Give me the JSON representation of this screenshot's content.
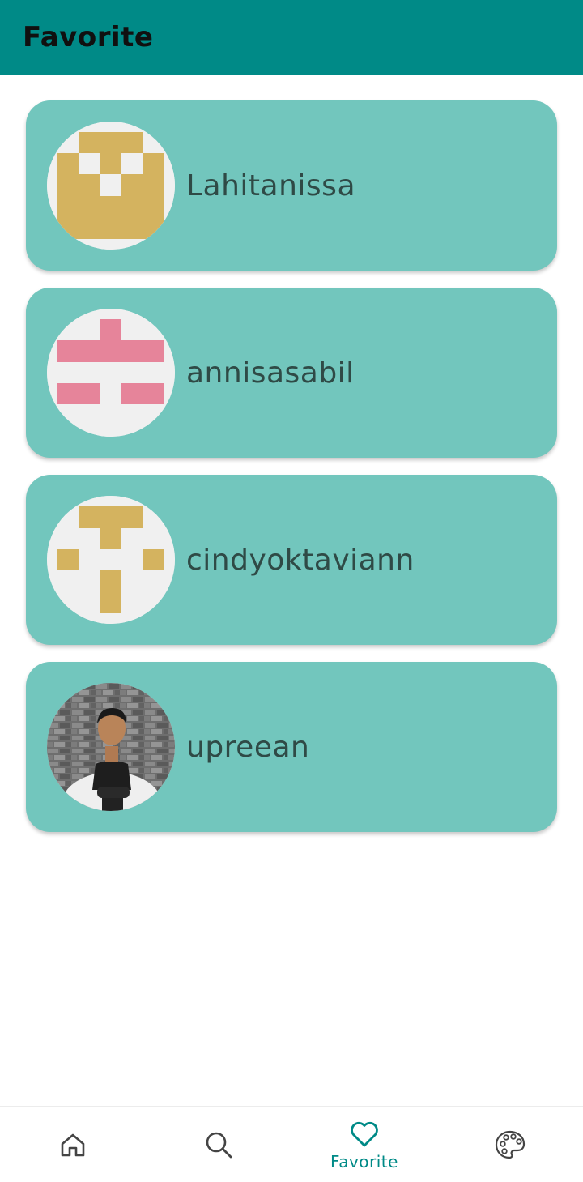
{
  "header": {
    "title": "Favorite"
  },
  "favorites": [
    {
      "username": "Lahitanissa",
      "avatar": "identicon-gold"
    },
    {
      "username": "annisasabil",
      "avatar": "identicon-pink"
    },
    {
      "username": "cindyoktaviann",
      "avatar": "identicon-gold-t"
    },
    {
      "username": "upreean",
      "avatar": "photo-person"
    }
  ],
  "nav": {
    "items": [
      {
        "icon": "home-icon",
        "label": ""
      },
      {
        "icon": "search-icon",
        "label": ""
      },
      {
        "icon": "heart-icon",
        "label": "Favorite",
        "active": true
      },
      {
        "icon": "palette-icon",
        "label": ""
      }
    ]
  },
  "colors": {
    "app_bar": "#008a87",
    "card": "#72c6bd",
    "accent": "#008a87",
    "identicon_gold": "#d4b35f",
    "identicon_pink": "#e6849a"
  }
}
